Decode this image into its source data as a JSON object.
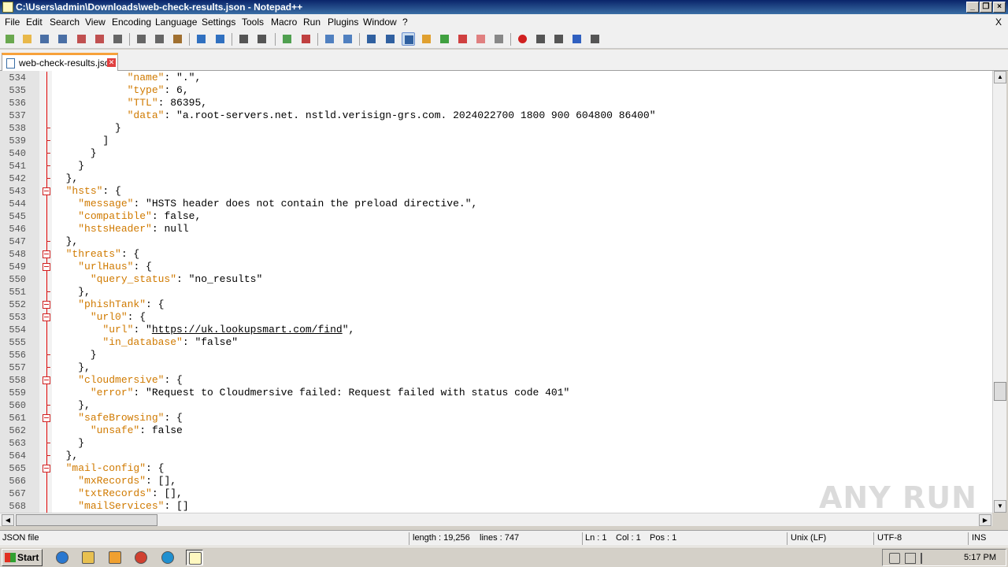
{
  "window": {
    "title": "C:\\Users\\admin\\Downloads\\web-check-results.json - Notepad++"
  },
  "menu": [
    "File",
    "Edit",
    "Search",
    "View",
    "Encoding",
    "Language",
    "Settings",
    "Tools",
    "Macro",
    "Run",
    "Plugins",
    "Window",
    "?"
  ],
  "menu_close": "X",
  "toolbar_icons": [
    "new-file-icon",
    "open-file-icon",
    "save-icon",
    "save-all-icon",
    "close-icon",
    "close-all-icon",
    "print-icon",
    "cut-icon",
    "copy-icon",
    "paste-icon",
    "undo-icon",
    "redo-icon",
    "find-icon",
    "replace-icon",
    "zoom-in-icon",
    "zoom-out-icon",
    "sync-vertical-icon",
    "sync-horizontal-icon",
    "word-wrap-icon",
    "show-all-chars-icon",
    "indent-guide-icon",
    "udl-icon",
    "doc-map-icon",
    "function-list-icon",
    "folder-workspace-icon",
    "monitoring-icon",
    "record-macro-icon",
    "stop-macro-icon",
    "play-macro-icon",
    "run-macro-multiple-icon",
    "save-macro-icon"
  ],
  "tab": {
    "label": "web-check-results.json"
  },
  "editor": {
    "lines": [
      {
        "n": "534",
        "text": "            \"name\": \".\","
      },
      {
        "n": "535",
        "text": "            \"type\": 6,"
      },
      {
        "n": "536",
        "text": "            \"TTL\": 86395,"
      },
      {
        "n": "537",
        "text": "            \"data\": \"a.root-servers.net. nstld.verisign-grs.com. 2024022700 1800 900 604800 86400\""
      },
      {
        "n": "538",
        "text": "          }"
      },
      {
        "n": "539",
        "text": "        ]"
      },
      {
        "n": "540",
        "text": "      }"
      },
      {
        "n": "541",
        "text": "    }"
      },
      {
        "n": "542",
        "text": "  },"
      },
      {
        "n": "543",
        "text": "  \"hsts\": {"
      },
      {
        "n": "544",
        "text": "    \"message\": \"HSTS header does not contain the preload directive.\","
      },
      {
        "n": "545",
        "text": "    \"compatible\": false,"
      },
      {
        "n": "546",
        "text": "    \"hstsHeader\": null"
      },
      {
        "n": "547",
        "text": "  },"
      },
      {
        "n": "548",
        "text": "  \"threats\": {"
      },
      {
        "n": "549",
        "text": "    \"urlHaus\": {"
      },
      {
        "n": "550",
        "text": "      \"query_status\": \"no_results\""
      },
      {
        "n": "551",
        "text": "    },"
      },
      {
        "n": "552",
        "text": "    \"phishTank\": {"
      },
      {
        "n": "553",
        "text": "      \"url0\": {"
      },
      {
        "n": "554",
        "text": "        \"url\": \"https://uk.lookupsmart.com/find\","
      },
      {
        "n": "555",
        "text": "        \"in_database\": \"false\""
      },
      {
        "n": "556",
        "text": "      }"
      },
      {
        "n": "557",
        "text": "    },"
      },
      {
        "n": "558",
        "text": "    \"cloudmersive\": {"
      },
      {
        "n": "559",
        "text": "      \"error\": \"Request to Cloudmersive failed: Request failed with status code 401\""
      },
      {
        "n": "560",
        "text": "    },"
      },
      {
        "n": "561",
        "text": "    \"safeBrowsing\": {"
      },
      {
        "n": "562",
        "text": "      \"unsafe\": false"
      },
      {
        "n": "563",
        "text": "    }"
      },
      {
        "n": "564",
        "text": "  },"
      },
      {
        "n": "565",
        "text": "  \"mail-config\": {"
      },
      {
        "n": "566",
        "text": "    \"mxRecords\": [],"
      },
      {
        "n": "567",
        "text": "    \"txtRecords\": [],"
      },
      {
        "n": "568",
        "text": "    \"mailServices\": []"
      }
    ]
  },
  "status": {
    "file_type": "JSON file",
    "length": "length : 19,256",
    "lines": "lines : 747",
    "ln": "Ln : 1",
    "col": "Col : 1",
    "pos": "Pos : 1",
    "eol": "Unix (LF)",
    "encoding": "UTF-8",
    "mode": "INS"
  },
  "taskbar": {
    "start_label": "Start",
    "apps": [
      "ie-icon",
      "explorer-icon",
      "media-player-icon",
      "chrome-icon",
      "edge-icon",
      "notepadpp-icon"
    ],
    "clock": "5:17 PM"
  },
  "watermark": "ANY RUN",
  "colors": {
    "key": "#d07a00",
    "fold": "#d02020",
    "title_bar": "#0a246a"
  }
}
